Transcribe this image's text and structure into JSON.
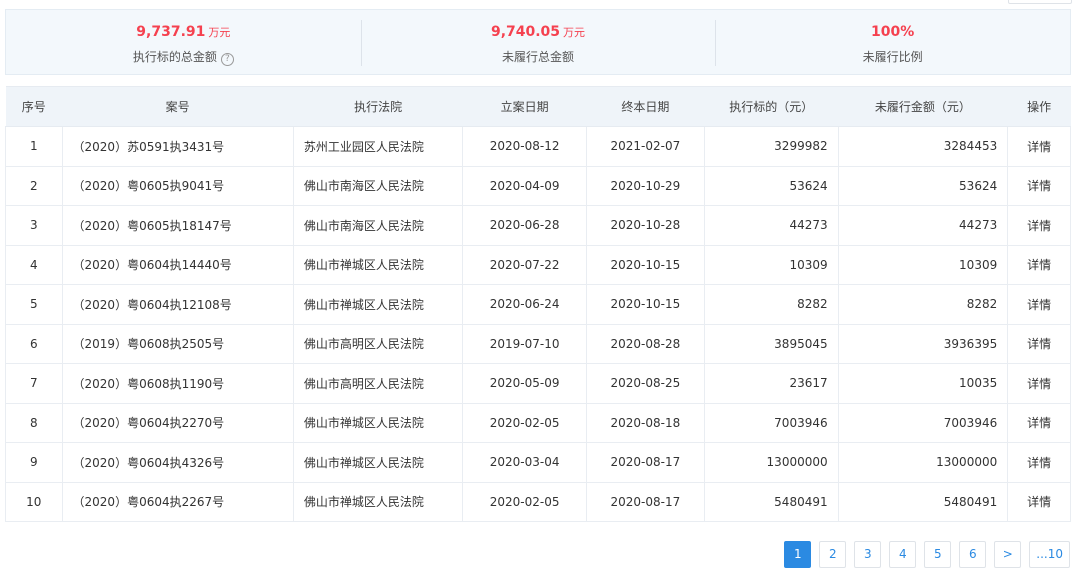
{
  "summary": [
    {
      "value": "9,737.91",
      "unit": "万元",
      "label": "执行标的总金额",
      "help_icon": "question-circle-icon"
    },
    {
      "value": "9,740.05",
      "unit": "万元",
      "label": "未履行总金额"
    },
    {
      "value": "100%",
      "unit": "",
      "label": "未履行比例"
    }
  ],
  "table": {
    "headers": [
      "序号",
      "案号",
      "执行法院",
      "立案日期",
      "终本日期",
      "执行标的（元）",
      "未履行金额（元）",
      "操作"
    ],
    "rows": [
      {
        "no": "1",
        "case": "（2020）苏0591执3431号",
        "court": "苏州工业园区人民法院",
        "filed": "2020-08-12",
        "end": "2021-02-07",
        "amount": "3299982",
        "unpaid": "3284453",
        "action": "详情"
      },
      {
        "no": "2",
        "case": "（2020）粤0605执9041号",
        "court": "佛山市南海区人民法院",
        "filed": "2020-04-09",
        "end": "2020-10-29",
        "amount": "53624",
        "unpaid": "53624",
        "action": "详情"
      },
      {
        "no": "3",
        "case": "（2020）粤0605执18147号",
        "court": "佛山市南海区人民法院",
        "filed": "2020-06-28",
        "end": "2020-10-28",
        "amount": "44273",
        "unpaid": "44273",
        "action": "详情"
      },
      {
        "no": "4",
        "case": "（2020）粤0604执14440号",
        "court": "佛山市禅城区人民法院",
        "filed": "2020-07-22",
        "end": "2020-10-15",
        "amount": "10309",
        "unpaid": "10309",
        "action": "详情"
      },
      {
        "no": "5",
        "case": "（2020）粤0604执12108号",
        "court": "佛山市禅城区人民法院",
        "filed": "2020-06-24",
        "end": "2020-10-15",
        "amount": "8282",
        "unpaid": "8282",
        "action": "详情"
      },
      {
        "no": "6",
        "case": "（2019）粤0608执2505号",
        "court": "佛山市高明区人民法院",
        "filed": "2019-07-10",
        "end": "2020-08-28",
        "amount": "3895045",
        "unpaid": "3936395",
        "action": "详情"
      },
      {
        "no": "7",
        "case": "（2020）粤0608执1190号",
        "court": "佛山市高明区人民法院",
        "filed": "2020-05-09",
        "end": "2020-08-25",
        "amount": "23617",
        "unpaid": "10035",
        "action": "详情"
      },
      {
        "no": "8",
        "case": "（2020）粤0604执2270号",
        "court": "佛山市禅城区人民法院",
        "filed": "2020-02-05",
        "end": "2020-08-18",
        "amount": "7003946",
        "unpaid": "7003946",
        "action": "详情"
      },
      {
        "no": "9",
        "case": "（2020）粤0604执4326号",
        "court": "佛山市禅城区人民法院",
        "filed": "2020-03-04",
        "end": "2020-08-17",
        "amount": "13000000",
        "unpaid": "13000000",
        "action": "详情"
      },
      {
        "no": "10",
        "case": "（2020）粤0604执2267号",
        "court": "佛山市禅城区人民法院",
        "filed": "2020-02-05",
        "end": "2020-08-17",
        "amount": "5480491",
        "unpaid": "5480491",
        "action": "详情"
      }
    ]
  },
  "pagination": {
    "pages": [
      "1",
      "2",
      "3",
      "4",
      "5",
      "6"
    ],
    "current": "1",
    "next_label": ">",
    "last_label": "...10"
  },
  "colors": {
    "accent": "#2b8ae2",
    "highlight": "#f5414f",
    "header_bg": "#eff4f9",
    "summary_bg": "#f3f8fc"
  }
}
